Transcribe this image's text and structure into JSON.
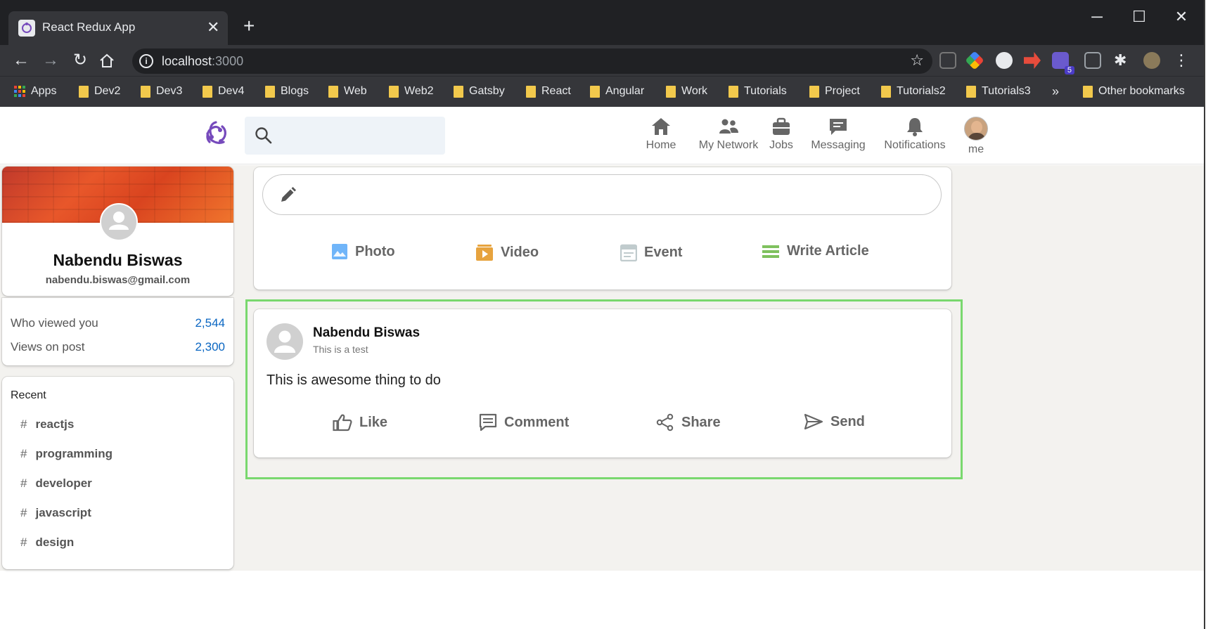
{
  "browser": {
    "tab_title": "React Redux App",
    "tab_close": "✕",
    "new_tab": "+",
    "url_host": "localhost",
    "url_port": ":3000",
    "window_controls": {
      "minimize": "─",
      "maximize": "☐",
      "close": "✕"
    },
    "extension_badge": "5",
    "bookmarks": {
      "apps": "Apps",
      "folders": [
        "Dev2",
        "Dev3",
        "Dev4",
        "Blogs",
        "Web",
        "Web2",
        "Gatsby",
        "React",
        "Angular",
        "Work",
        "Tutorials",
        "Project",
        "Tutorials2",
        "Tutorials3"
      ],
      "overflow": "»",
      "other": "Other bookmarks"
    }
  },
  "header": {
    "logo_icon": "redux-logo-icon",
    "nav": [
      {
        "label": "Home",
        "icon": "home-icon"
      },
      {
        "label": "My Network",
        "icon": "network-icon"
      },
      {
        "label": "Jobs",
        "icon": "briefcase-icon"
      },
      {
        "label": "Messaging",
        "icon": "message-icon"
      },
      {
        "label": "Notifications",
        "icon": "bell-icon"
      },
      {
        "label": "me",
        "icon": "avatar"
      }
    ]
  },
  "sidebar": {
    "profile": {
      "name": "Nabendu Biswas",
      "email": "nabendu.biswas@gmail.com"
    },
    "stats": [
      {
        "label": "Who viewed you",
        "value": "2,544"
      },
      {
        "label": "Views on post",
        "value": "2,300"
      }
    ],
    "recent": {
      "title": "Recent",
      "hash": "#",
      "tags": [
        "reactjs",
        "programming",
        "developer",
        "javascript",
        "design"
      ]
    }
  },
  "share_box": {
    "actions": [
      {
        "label": "Photo",
        "icon": "photo-icon",
        "color": "#70b5f9"
      },
      {
        "label": "Video",
        "icon": "video-icon",
        "color": "#e7a33e"
      },
      {
        "label": "Event",
        "icon": "calendar-icon",
        "color": "#c0cbcd"
      },
      {
        "label": "Write Article",
        "icon": "article-icon",
        "color": "#7fc15e"
      }
    ]
  },
  "post": {
    "author": "Nabendu Biswas",
    "subtitle": "This is a test",
    "message": "This is awesome thing to do",
    "actions": [
      {
        "label": "Like",
        "icon": "thumbs-up-icon"
      },
      {
        "label": "Comment",
        "icon": "comment-icon"
      },
      {
        "label": "Share",
        "icon": "share-icon"
      },
      {
        "label": "Send",
        "icon": "send-icon"
      }
    ],
    "highlight_color": "#79d86e"
  },
  "colors": {
    "accent": "#0a66c2",
    "redux_purple": "#764abc",
    "page_bg": "#f3f2ef",
    "chrome_dark": "#202124"
  }
}
